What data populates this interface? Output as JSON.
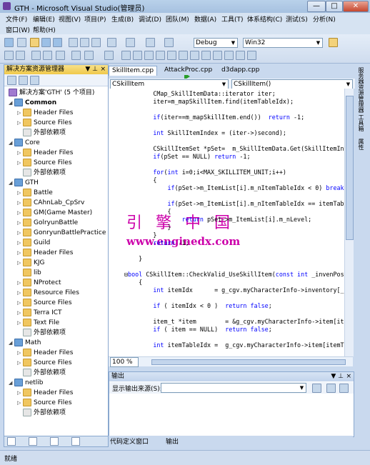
{
  "window": {
    "title": "GTH - Microsoft Visual Studio(管理员)",
    "controls": {
      "minimize": "—",
      "maximize": "□",
      "close": "✕"
    }
  },
  "menu": {
    "row1": [
      "文件(F)",
      "编辑(E)",
      "视图(V)",
      "项目(P)",
      "生成(B)",
      "调试(D)",
      "团队(M)",
      "数据(A)",
      "工具(T)",
      "体系结构(C)",
      "测试(S)",
      "分析(N)"
    ],
    "row2": [
      "窗口(W)",
      "帮助(H)"
    ]
  },
  "toolbar": {
    "config": "Debug",
    "platform": "Win32"
  },
  "solution_explorer": {
    "title": "解决方案资源管理器",
    "pin": "▼ ⊥",
    "close": "×",
    "root": "解决方案'GTH' (5 个项目)",
    "items": [
      {
        "label": "Common",
        "kind": "proj",
        "level": 1,
        "bold": true,
        "expander": "◢"
      },
      {
        "label": "Header Files",
        "kind": "folder",
        "level": 2,
        "expander": "▷"
      },
      {
        "label": "Source Files",
        "kind": "folder",
        "level": 2,
        "expander": "▷"
      },
      {
        "label": "外部依赖项",
        "kind": "ref",
        "level": 2,
        "expander": ""
      },
      {
        "label": "Core",
        "kind": "proj",
        "level": 1,
        "expander": "◢"
      },
      {
        "label": "Header Files",
        "kind": "folder",
        "level": 2,
        "expander": "▷"
      },
      {
        "label": "Source Files",
        "kind": "folder",
        "level": 2,
        "expander": "▷"
      },
      {
        "label": "外部依赖项",
        "kind": "ref",
        "level": 2,
        "expander": ""
      },
      {
        "label": "GTH",
        "kind": "proj",
        "level": 1,
        "expander": "◢"
      },
      {
        "label": "Battle",
        "kind": "folder",
        "level": 2,
        "expander": "▷"
      },
      {
        "label": "CAhnLab_CpSrv",
        "kind": "folder",
        "level": 2,
        "expander": "▷"
      },
      {
        "label": "GM(Game Master)",
        "kind": "folder",
        "level": 2,
        "expander": "▷"
      },
      {
        "label": "GolryunBattle",
        "kind": "folder",
        "level": 2,
        "expander": "▷"
      },
      {
        "label": "GonryunBattlePractice",
        "kind": "folder",
        "level": 2,
        "expander": "▷"
      },
      {
        "label": "Guild",
        "kind": "folder",
        "level": 2,
        "expander": "▷"
      },
      {
        "label": "Header Files",
        "kind": "folder",
        "level": 2,
        "expander": "▷"
      },
      {
        "label": "KJG",
        "kind": "folder",
        "level": 2,
        "expander": "▷"
      },
      {
        "label": "lib",
        "kind": "folder",
        "level": 2,
        "expander": ""
      },
      {
        "label": "NProtect",
        "kind": "folder",
        "level": 2,
        "expander": "▷"
      },
      {
        "label": "Resource Files",
        "kind": "folder",
        "level": 2,
        "expander": "▷"
      },
      {
        "label": "Source Files",
        "kind": "folder",
        "level": 2,
        "expander": "▷"
      },
      {
        "label": "Terra ICT",
        "kind": "folder",
        "level": 2,
        "expander": "▷"
      },
      {
        "label": "Text File",
        "kind": "folder",
        "level": 2,
        "expander": "▷"
      },
      {
        "label": "外部依赖项",
        "kind": "ref",
        "level": 2,
        "expander": ""
      },
      {
        "label": "Math",
        "kind": "proj",
        "level": 1,
        "expander": "◢"
      },
      {
        "label": "Header Files",
        "kind": "folder",
        "level": 2,
        "expander": "▷"
      },
      {
        "label": "Source Files",
        "kind": "folder",
        "level": 2,
        "expander": "▷"
      },
      {
        "label": "外部依赖项",
        "kind": "ref",
        "level": 2,
        "expander": ""
      },
      {
        "label": "netlib",
        "kind": "proj",
        "level": 1,
        "expander": "◢"
      },
      {
        "label": "Header Files",
        "kind": "folder",
        "level": 2,
        "expander": "▷"
      },
      {
        "label": "Source Files",
        "kind": "folder",
        "level": 2,
        "expander": "▷"
      },
      {
        "label": "外部依赖项",
        "kind": "ref",
        "level": 2,
        "expander": ""
      }
    ]
  },
  "editor": {
    "tabs": [
      "SkillItem.cpp",
      "AttackProc.cpp",
      "d3dapp.cpp"
    ],
    "active_tab": "SkillItem.cpp",
    "nav_left": "CSkillItem",
    "nav_right": "CSkillItem()",
    "zoom": "100 %",
    "watermark_cn": "引 擎 中 国",
    "watermark_url": "www.enginedx.com",
    "lines": [
      {
        "t": "        CMap_SkillItemData::iterator iter;"
      },
      {
        "t": "        iter=m_mapSkillItem.find(itemTableIdx);"
      },
      {
        "t": ""
      },
      {
        "t": "        if(iter==m_mapSkillItem.end())  return -1;"
      },
      {
        "t": ""
      },
      {
        "t": "        int SkillItemIndex = (iter->)second);"
      },
      {
        "t": ""
      },
      {
        "t": "        CSkillItemSet *pSet=  m_SkillItemData.Get(SkillItemIndex);"
      },
      {
        "t": "        if(pSet == NULL) return -1;"
      },
      {
        "t": ""
      },
      {
        "t": "        for(int i=0;i<MAX_SKILLITEM_UNIT;i++)"
      },
      {
        "t": "        {"
      },
      {
        "t": "            if(pSet->m_ItemList[i].m_nItemTableIdx < 0) break;"
      },
      {
        "t": ""
      },
      {
        "t": "            if(pSet->m_ItemList[i].m_nItemTableIdx == itemTableIdx"
      },
      {
        "t": "            {"
      },
      {
        "t": "                return pSet->m_ItemList[i].m_nLevel;"
      },
      {
        "t": "            }"
      },
      {
        "t": "        }"
      },
      {
        "t": "        return -1;"
      },
      {
        "t": ""
      },
      {
        "t": "    }"
      },
      {
        "t": ""
      },
      {
        "t": "⊟bool CSkillItem::CheckValid_UseSkillItem(const int _invenPos)"
      },
      {
        "t": "    {"
      },
      {
        "t": "        int itemIdx      = g_cgv.myCharacterInfo->inventory[_invenP"
      },
      {
        "t": ""
      },
      {
        "t": "        if ( itemIdx < 0 )  return false;"
      },
      {
        "t": ""
      },
      {
        "t": "        item_t *item        = &g_cgv.myCharacterInfo->item[itemIdx"
      },
      {
        "t": "        if ( item == NULL)  return false;"
      },
      {
        "t": ""
      },
      {
        "t": "        int itemTableIdx =  g_cgv.myCharacterInfo->item[itemTableI"
      }
    ]
  },
  "output": {
    "title": "输出",
    "source_label": "显示输出来源(S):"
  },
  "bottom_tabs": [
    "代码定义窗口",
    "输出"
  ],
  "right_strip": [
    "服务器资源管理器",
    "工具箱",
    "属性"
  ],
  "status": "就绪",
  "colors": {
    "keyword": "#0000ff",
    "watermark": "#cc00aa",
    "title_bg": "#b9d1ea"
  }
}
